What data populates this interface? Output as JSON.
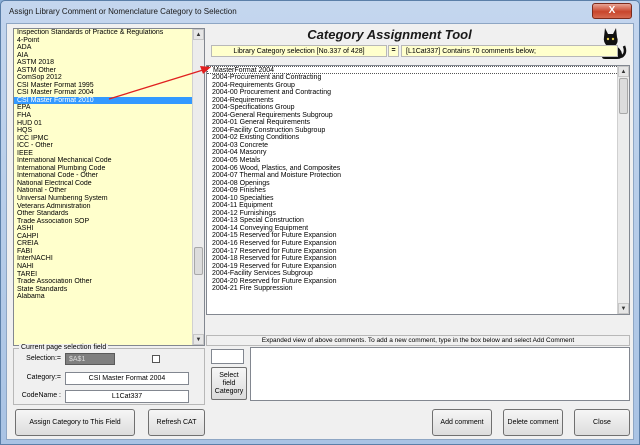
{
  "window": {
    "title": "Assign Library Comment or Nomenclature Category to Selection",
    "close_glyph": "X"
  },
  "header": {
    "title": "Category Assignment Tool",
    "icon": "black-cat-logo-icon"
  },
  "selection_info": {
    "library_category": "Library Category selection [No.337 of 428]",
    "equals": "=",
    "count_text": "[L1Cat337] Contains 70 comments below;"
  },
  "category_list": {
    "selected_index": 9,
    "items": [
      "Inspection Standards of Practice & Regulations",
      "4-Point",
      "ADA",
      "AIA",
      "ASTM 2018",
      "ASTM Other",
      "ComSop 2012",
      "CSI Master Format 1995",
      "CSI Master Format 2004",
      "CSI Master Format 2010",
      "EPA",
      "FHA",
      "HUD 01",
      "HQS",
      "ICC IPMC",
      "ICC - Other",
      "IEEE",
      "International Mechanical Code",
      "International Plumbing Code",
      "International Code - Other",
      "National Electrical Code",
      "National - Other",
      "Universal Numbering System",
      "Veterans Administration",
      "Other Standards",
      "Trade Association SOP",
      "ASHI",
      "CAHPI",
      "CREIA",
      "FABI",
      "InterNACHI",
      "NAHI",
      "TAREI",
      "Trade Association Other",
      "State Standards",
      "Alabama"
    ]
  },
  "comment_list": {
    "items": [
      "MasterFormat 2004",
      "2004-Procurement and Contracting",
      "2004-Requirements Group",
      "2004-00 Procurement and Contracting",
      "2004-Requirements",
      "2004-Specifications Group",
      "2004-General Requirements Subgroup",
      "2004-01 General Requirements",
      "2004-Facility Construction Subgroup",
      "2004-02 Existing Conditions",
      "2004-03 Concrete",
      "2004-04 Masonry",
      "2004-05 Metals",
      "2004-06 Wood, Plastics, and Composites",
      "2004-07 Thermal and Moisture Protection",
      "2004-08 Openings",
      "2004-09 Finishes",
      "2004-10 Specialties",
      "2004-11 Equipment",
      "2004-12 Furnishings",
      "2004-13 Special Construction",
      "2004-14 Conveying Equipment",
      "2004-15 Reserved for Future Expansion",
      "2004-16 Reserved for Future Expansion",
      "2004-17 Reserved for Future Expansion",
      "2004-18 Reserved for Future Expansion",
      "2004-19 Reserved for Future Expansion",
      "2004-Facility Services Subgroup",
      "2004-20 Reserved for Future Expansion",
      "2004-21 Fire Suppression"
    ]
  },
  "expanded": {
    "label": "Expanded view of above comments. To add a new comment, type in the box below and select Add Comment",
    "select_field_label": "Select field Category",
    "new_comment_value": ""
  },
  "current_field": {
    "group_title": "Current page selection field",
    "selection_label": "Selection:=",
    "selection_value": "$A$1",
    "category_label": "Category:=",
    "category_value": "CSI Master Format 2004",
    "codename_label": "CodeName :",
    "codename_value": "L1Cat337"
  },
  "buttons": {
    "assign": "Assign Category to This Field",
    "refresh": "Refresh CAT",
    "add_comment": "Add comment",
    "delete_comment": "Delete comment",
    "close": "Close"
  },
  "colors": {
    "list_background": "#ffffcc",
    "selection_highlight": "#3399ff",
    "arrow": "#e02020"
  }
}
